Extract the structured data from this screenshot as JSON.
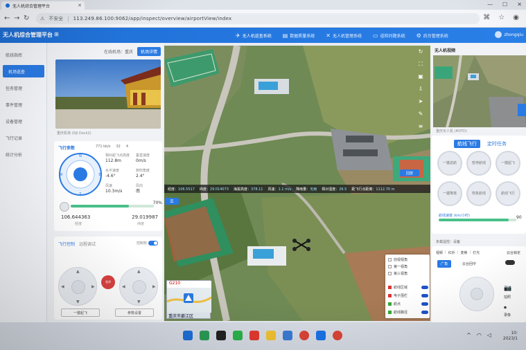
{
  "browser": {
    "tab_title": "无人机综合管理平台",
    "security_label": "不安全",
    "url": "113.249.86.100:9062/app/inspect/overview/airportView/index"
  },
  "header": {
    "title": "无人机综合管理平台",
    "nav": [
      {
        "label": "无人机巡查系统",
        "icon": "drone-icon"
      },
      {
        "label": "数据质量系统",
        "icon": "database-icon"
      },
      {
        "label": "无人机管理系统",
        "icon": "drone-manage-icon"
      },
      {
        "label": "巡检问题系统",
        "icon": "folder-icon"
      },
      {
        "label": "后台管理系统",
        "icon": "gear-icon"
      }
    ],
    "user": "zhongqiu"
  },
  "sidebar": {
    "items": [
      {
        "label": "航线指挥"
      },
      {
        "label": "机场巡查"
      },
      {
        "label": "任务管理"
      },
      {
        "label": "事件管理"
      },
      {
        "label": "设备管理"
      },
      {
        "label": "飞行记录"
      },
      {
        "label": "统计分析"
      }
    ]
  },
  "left_panel": {
    "head_label": "在线机场：重庆",
    "head_pill": "机场详情",
    "camera_caption": "重庆机场 (DJI Dock2)",
    "flight_params": {
      "title": "飞行参数",
      "stats_top": [
        "771 kb/s",
        "32",
        "4"
      ],
      "altitude_label": "相对起飞点高度",
      "altitude": "112.8m",
      "vspeed_label": "垂直速度",
      "vspeed": "0m/s",
      "hspeed_label": "水平速度",
      "hspeed": "-4.6°",
      "pitch_label": "俯仰角度",
      "pitch": "2.4°",
      "wind_label": "风速",
      "wind": "10.3m/s",
      "wind_dir_label": "风向",
      "wind_dir": "南",
      "battery_pct": 70,
      "battery_text": "70%",
      "longitude": "106.644363",
      "latitude": "29.019987",
      "lon_label": "经度",
      "lat_label": "纬度"
    },
    "control": {
      "tab1": "飞行控制",
      "tab2": "远程调试",
      "toggle_label": "控制权",
      "stop_label": "急停",
      "btn_takeoff": "一键起飞",
      "btn_params": "参数设置"
    }
  },
  "telemetry": {
    "items": [
      {
        "k": "经度：",
        "v": "106.5517"
      },
      {
        "k": "纬度：",
        "v": "29.014073"
      },
      {
        "k": "海拔高度：",
        "v": "378.11"
      },
      {
        "k": "风速：",
        "v": "1.1 m/s"
      },
      {
        "k": "降雨量：",
        "v": "无雨"
      },
      {
        "k": "相对湿度：",
        "v": "26.5"
      },
      {
        "k": "距飞行点距离：",
        "v": "1112.70 m"
      }
    ]
  },
  "map": {
    "replay_label": "回放",
    "minimap_label": "G210",
    "minimap_city": "重庆市綦江区",
    "layers": [
      {
        "label": "前视视角"
      },
      {
        "label": "第一视角"
      },
      {
        "label": "第三视角"
      }
    ],
    "layer_toggles": [
      {
        "label": "航线区域",
        "color": "#d33"
      },
      {
        "label": "电子围栏",
        "color": "#d33"
      },
      {
        "label": "航点",
        "color": "#3a3"
      },
      {
        "label": "航线路径",
        "color": "#3a3"
      }
    ]
  },
  "right_panel": {
    "title": "无人机视频",
    "video_caption": "重庆无人机 (M3TD)",
    "tabs": [
      "航线飞行",
      "定时任务"
    ],
    "buttons": [
      "一键返航",
      "暂停航线",
      "一键起飞",
      "一键降落",
      "恢复航线",
      "航线飞行"
    ],
    "speed_label": "航线速度 (km/小时)",
    "speed_text": "90",
    "speed_pct": 90,
    "note": "负载遥控：设备",
    "card2_tabs": [
      "视频",
      "红外",
      "变焦",
      "灯光"
    ],
    "card2_right": "云台锁定",
    "wide_label": "广角",
    "label_photo": "拍照",
    "label_record": "录像",
    "label_reset": "云台回中"
  },
  "taskbar": {
    "time": "10:",
    "date": "2023/1"
  }
}
